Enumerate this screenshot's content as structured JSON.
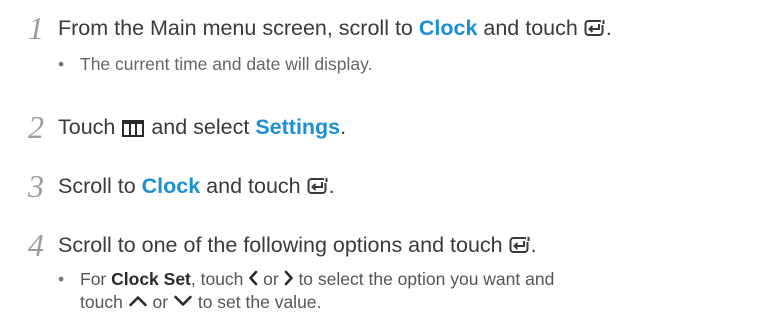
{
  "steps": [
    {
      "number": "1",
      "text_before": "From the Main menu screen, scroll to ",
      "keyword": "Clock",
      "text_middle": " and touch ",
      "icon": "enter-icon",
      "text_after": ".",
      "bullet": "The current time and date will display."
    },
    {
      "number": "2",
      "text_before": "Touch ",
      "icon": "menu-icon",
      "text_middle": " and select ",
      "keyword": "Settings",
      "text_after": "."
    },
    {
      "number": "3",
      "text_before": "Scroll to ",
      "keyword": "Clock",
      "text_middle": " and touch ",
      "icon": "enter-icon",
      "text_after": "."
    },
    {
      "number": "4",
      "text_before": "Scroll to one of the following options and touch ",
      "icon": "enter-icon",
      "text_after": ".",
      "bullet": {
        "prefix": "For ",
        "option": "Clock Set",
        "text1": ", touch ",
        "left_icon": "chevron-left-icon",
        "or1": " or ",
        "right_icon": "chevron-right-icon",
        "text2": " to select the option you want and",
        "line2_start": "touch ",
        "up_icon": "chevron-up-icon",
        "or2": " or ",
        "down_icon": "chevron-down-icon",
        "text3": " to set the value."
      }
    }
  ],
  "colors": {
    "keyword": "#1a8fd8",
    "step_number": "#9c9c9c",
    "body_text": "#3a3a3a"
  }
}
